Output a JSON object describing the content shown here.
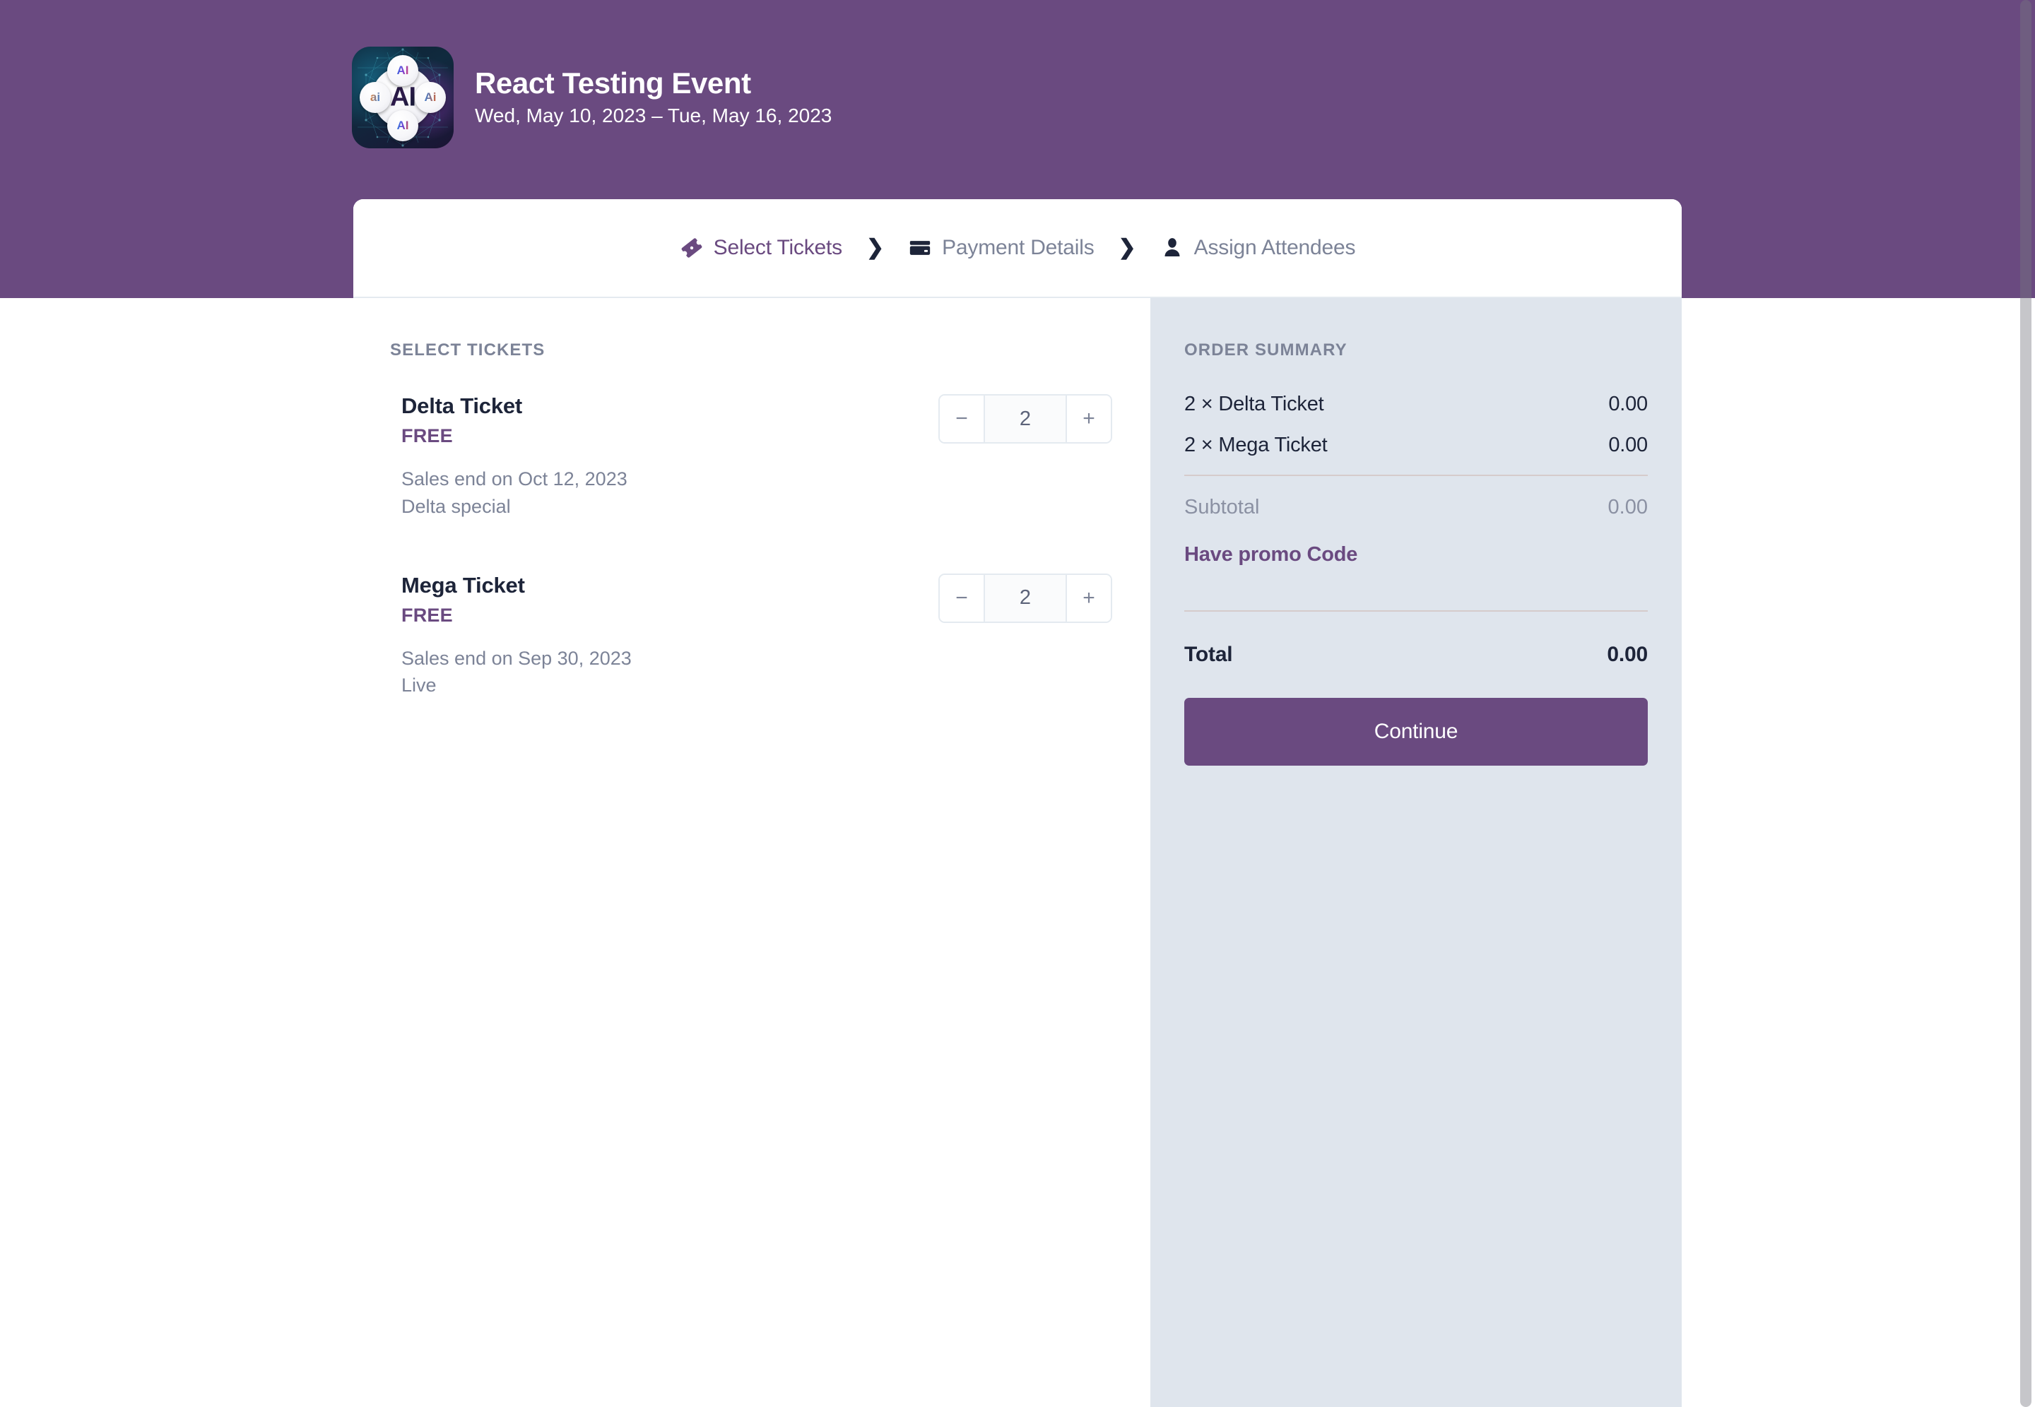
{
  "theme": {
    "brand_purple": "#6A4A80",
    "summary_bg": "#dfe5ed",
    "text_dark": "#1d2439",
    "text_muted": "#7c8397",
    "divider": "#d5cbcb",
    "border": "#e4eaf0"
  },
  "header": {
    "logo_alt": "AI network event logo",
    "logo_center_text": "AI",
    "logo_badges": [
      "AI",
      "AI",
      "ai",
      "Ai"
    ],
    "title": "React Testing Event",
    "dates": "Wed, May 10, 2023 – Tue, May 16, 2023"
  },
  "stepnav": {
    "chevron": "❯",
    "steps": [
      {
        "label": "Select Tickets",
        "icon": "ticket-icon",
        "active": true
      },
      {
        "label": "Payment Details",
        "icon": "credit-card-icon",
        "active": false
      },
      {
        "label": "Assign Attendees",
        "icon": "person-icon",
        "active": false
      }
    ]
  },
  "tickets_panel": {
    "heading": "SELECT TICKETS",
    "tickets": [
      {
        "name": "Delta Ticket",
        "price": "FREE",
        "sales_end": "Sales end on Oct 12, 2023",
        "description": "Delta special",
        "quantity": "2",
        "minus_label": "−",
        "plus_label": "+"
      },
      {
        "name": "Mega Ticket",
        "price": "FREE",
        "sales_end": "Sales end on Sep 30, 2023",
        "description": "Live",
        "quantity": "2",
        "minus_label": "−",
        "plus_label": "+"
      }
    ]
  },
  "order_summary": {
    "heading": "ORDER SUMMARY",
    "line_items": [
      {
        "label": "2 × Delta Ticket",
        "amount": "0.00"
      },
      {
        "label": "2 × Mega Ticket",
        "amount": "0.00"
      }
    ],
    "subtotal_label": "Subtotal",
    "subtotal_amount": "0.00",
    "promo_label": "Have promo Code",
    "total_label": "Total",
    "total_amount": "0.00",
    "continue_label": "Continue"
  }
}
